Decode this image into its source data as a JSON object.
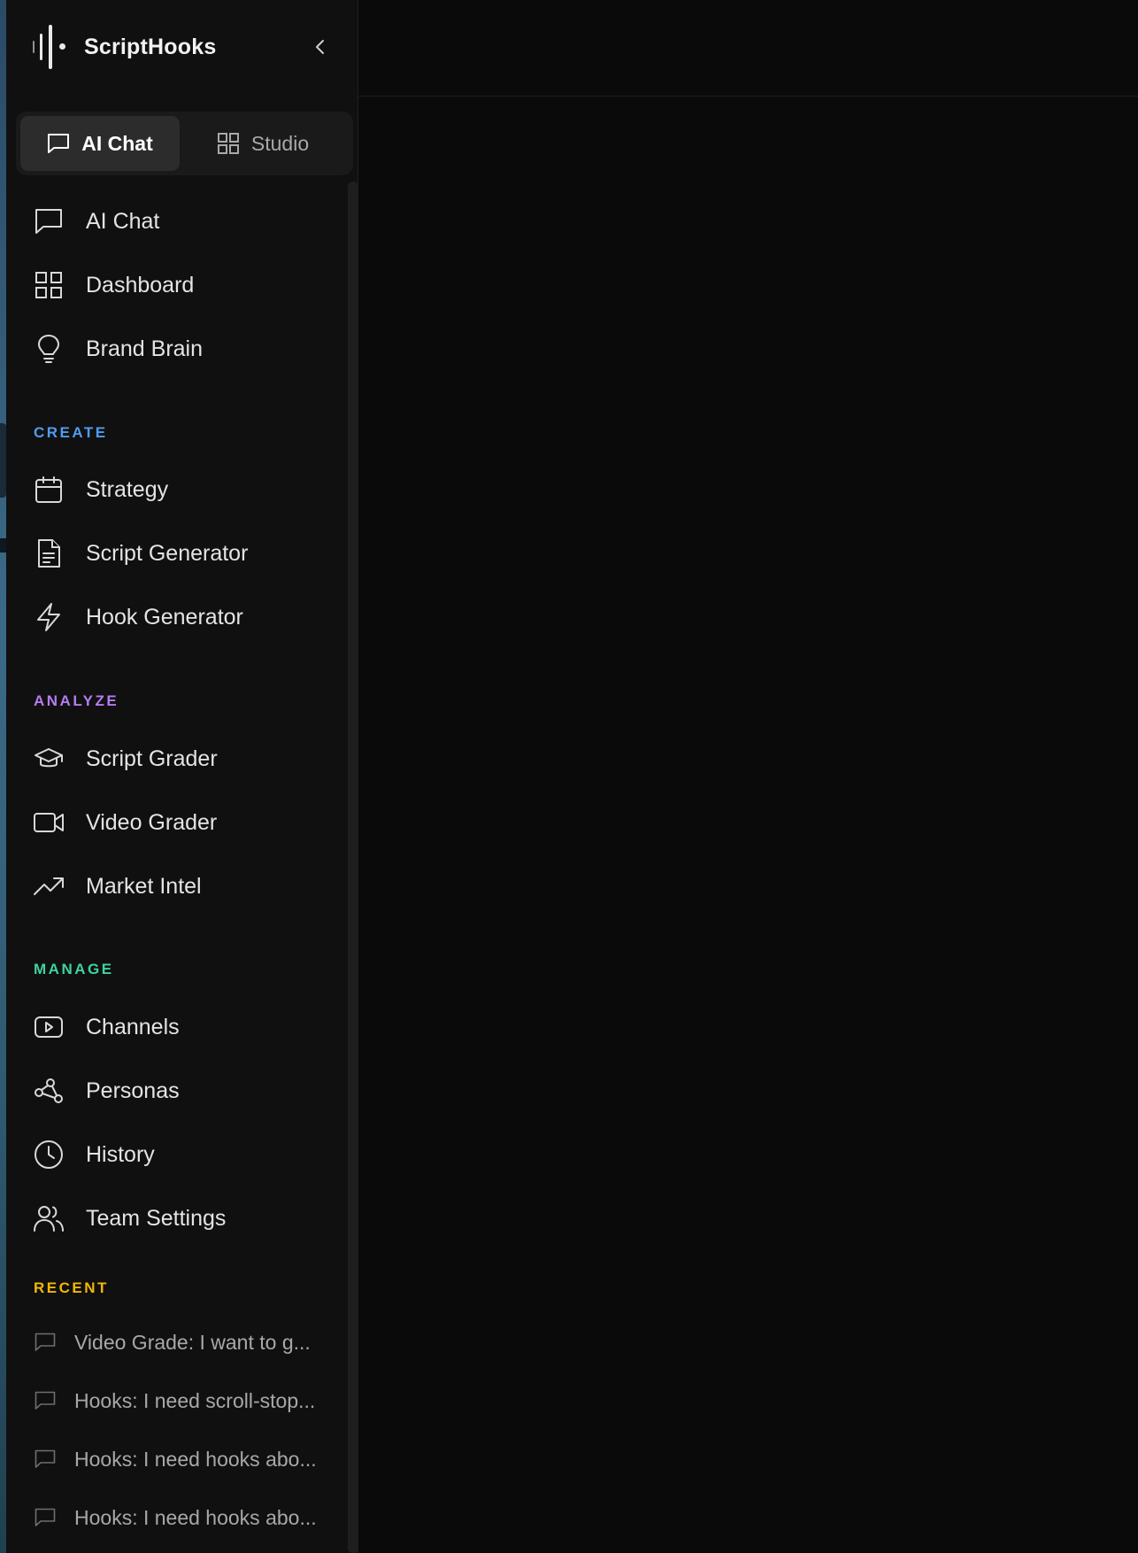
{
  "brand": {
    "name": "ScriptHooks"
  },
  "mode_switch": {
    "active": "AI Chat",
    "inactive": "Studio"
  },
  "nav": {
    "top": [
      {
        "label": "AI Chat",
        "icon": "chat-icon"
      },
      {
        "label": "Dashboard",
        "icon": "grid-icon"
      },
      {
        "label": "Brand Brain",
        "icon": "lightbulb-icon"
      }
    ],
    "create": {
      "title": "CREATE",
      "items": [
        {
          "label": "Strategy",
          "icon": "calendar-icon"
        },
        {
          "label": "Script Generator",
          "icon": "document-icon"
        },
        {
          "label": "Hook Generator",
          "icon": "lightning-icon"
        }
      ]
    },
    "analyze": {
      "title": "ANALYZE",
      "items": [
        {
          "label": "Script Grader",
          "icon": "graduation-cap-icon"
        },
        {
          "label": "Video Grader",
          "icon": "video-camera-icon"
        },
        {
          "label": "Market Intel",
          "icon": "trending-up-icon"
        }
      ]
    },
    "manage": {
      "title": "MANAGE",
      "items": [
        {
          "label": "Channels",
          "icon": "play-square-icon"
        },
        {
          "label": "Personas",
          "icon": "network-icon"
        },
        {
          "label": "History",
          "icon": "clock-icon"
        },
        {
          "label": "Team Settings",
          "icon": "users-icon"
        }
      ]
    },
    "recent": {
      "title": "RECENT",
      "items": [
        {
          "label": "Video Grade: I want to g..."
        },
        {
          "label": "Hooks: I need scroll-stop..."
        },
        {
          "label": "Hooks: I need hooks abo..."
        },
        {
          "label": "Hooks: I need hooks abo..."
        }
      ]
    }
  },
  "colors": {
    "create": "#4f9df0",
    "analyze": "#b57cf2",
    "manage": "#3ed3a0",
    "recent": "#f2b705"
  }
}
